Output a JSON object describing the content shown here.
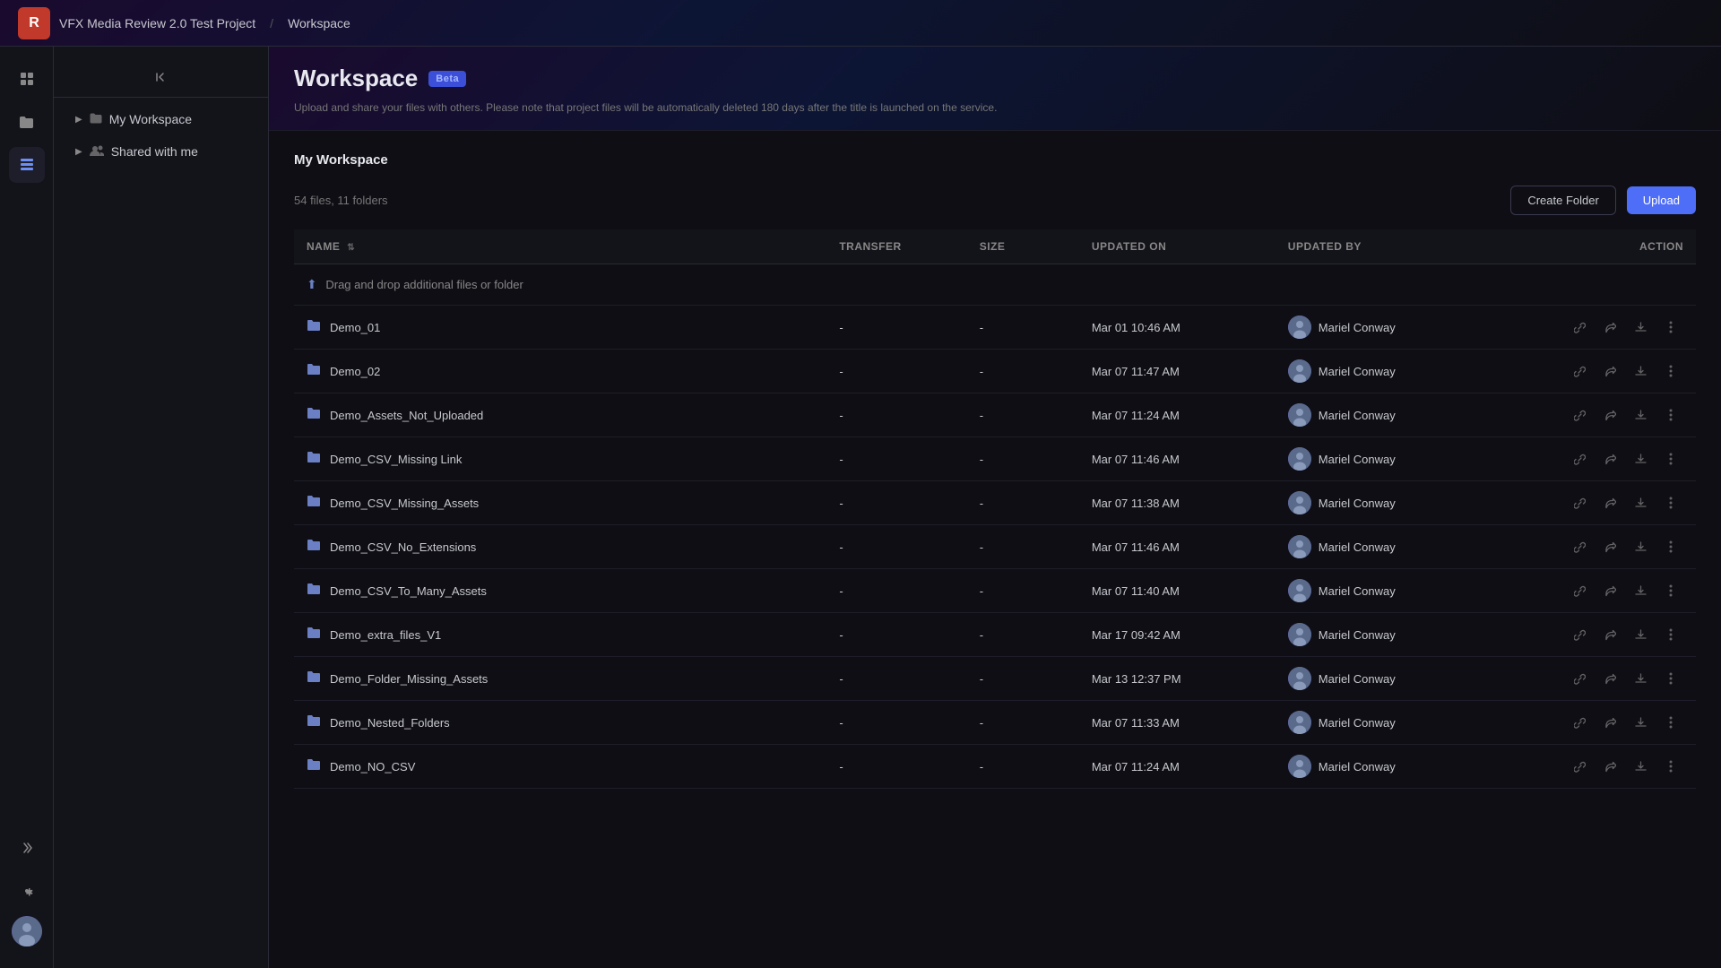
{
  "topbar": {
    "logo_text": "R",
    "project_title": "VFX Media Review 2.0 Test Project",
    "separator": "/",
    "section": "Workspace"
  },
  "header": {
    "title": "Workspace",
    "beta_label": "Beta",
    "description": "Upload and share your files with others. Please note that project files will be automatically deleted 180 days after the title is launched on the service."
  },
  "sidebar": {
    "my_workspace_label": "My Workspace",
    "shared_label": "Shared with me"
  },
  "section_title": "My Workspace",
  "toolbar": {
    "files_count": "54 files, 11 folders",
    "create_folder_label": "Create Folder",
    "upload_label": "Upload"
  },
  "table": {
    "columns": {
      "name": "Name",
      "transfer": "Transfer",
      "size": "Size",
      "updated_on": "Updated On",
      "updated_by": "Updated By",
      "action": "Action"
    },
    "drag_drop_text": "Drag and drop additional files or folder",
    "rows": [
      {
        "id": 1,
        "name": "Demo_01",
        "transfer": "-",
        "size": "-",
        "updated_on": "Mar 01 10:46 AM",
        "updated_by": "Mariel Conway"
      },
      {
        "id": 2,
        "name": "Demo_02",
        "transfer": "-",
        "size": "-",
        "updated_on": "Mar 07 11:47 AM",
        "updated_by": "Mariel Conway"
      },
      {
        "id": 3,
        "name": "Demo_Assets_Not_Uploaded",
        "transfer": "-",
        "size": "-",
        "updated_on": "Mar 07 11:24 AM",
        "updated_by": "Mariel Conway"
      },
      {
        "id": 4,
        "name": "Demo_CSV_Missing Link",
        "transfer": "-",
        "size": "-",
        "updated_on": "Mar 07 11:46 AM",
        "updated_by": "Mariel Conway"
      },
      {
        "id": 5,
        "name": "Demo_CSV_Missing_Assets",
        "transfer": "-",
        "size": "-",
        "updated_on": "Mar 07 11:38 AM",
        "updated_by": "Mariel Conway"
      },
      {
        "id": 6,
        "name": "Demo_CSV_No_Extensions",
        "transfer": "-",
        "size": "-",
        "updated_on": "Mar 07 11:46 AM",
        "updated_by": "Mariel Conway"
      },
      {
        "id": 7,
        "name": "Demo_CSV_To_Many_Assets",
        "transfer": "-",
        "size": "-",
        "updated_on": "Mar 07 11:40 AM",
        "updated_by": "Mariel Conway"
      },
      {
        "id": 8,
        "name": "Demo_extra_files_V1",
        "transfer": "-",
        "size": "-",
        "updated_on": "Mar 17 09:42 AM",
        "updated_by": "Mariel Conway"
      },
      {
        "id": 9,
        "name": "Demo_Folder_Missing_Assets",
        "transfer": "-",
        "size": "-",
        "updated_on": "Mar 13 12:37 PM",
        "updated_by": "Mariel Conway"
      },
      {
        "id": 10,
        "name": "Demo_Nested_Folders",
        "transfer": "-",
        "size": "-",
        "updated_on": "Mar 07 11:33 AM",
        "updated_by": "Mariel Conway"
      },
      {
        "id": 11,
        "name": "Demo_NO_CSV",
        "transfer": "-",
        "size": "-",
        "updated_on": "Mar 07 11:24 AM",
        "updated_by": "Mariel Conway"
      }
    ]
  }
}
